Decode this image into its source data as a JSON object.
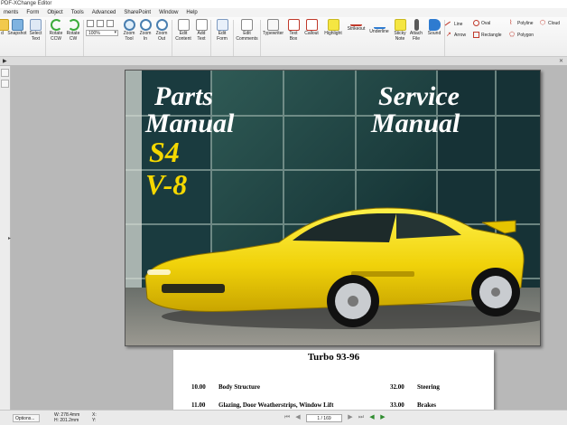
{
  "window": {
    "title": "PDF-XChange Editor"
  },
  "menu": [
    "ments",
    "Form",
    "Object",
    "Tools",
    "Advanced",
    "SharePoint",
    "Window",
    "Help"
  ],
  "toolbar": {
    "hand": {
      "line1": "d",
      "line2": ""
    },
    "snapshot": {
      "line1": "Snapshot",
      "line2": ""
    },
    "select_text": {
      "line1": "Select",
      "line2": "Text"
    },
    "rotate_ccw": {
      "line1": "Rotate",
      "line2": "CCW"
    },
    "rotate_cw": {
      "line1": "Rotate",
      "line2": "CW"
    },
    "zoom_value": "100%",
    "zoom_tool": {
      "line1": "Zoom",
      "line2": "Tool"
    },
    "zoom_in": {
      "line1": "Zoom",
      "line2": "In"
    },
    "zoom_out": {
      "line1": "Zoom",
      "line2": "Out"
    },
    "edit_content": {
      "line1": "Edit",
      "line2": "Content"
    },
    "add_text": {
      "line1": "Add",
      "line2": "Text"
    },
    "edit_form": {
      "line1": "Edit",
      "line2": "Form"
    },
    "edit_comments": {
      "line1": "Edit",
      "line2": "Comments"
    },
    "typewriter": {
      "line1": "Typewriter",
      "line2": ""
    },
    "text_box": {
      "line1": "Text",
      "line2": "Box"
    },
    "callout": {
      "line1": "Callout",
      "line2": ""
    },
    "highlight": {
      "line1": "Highlight",
      "line2": ""
    },
    "strikeout": {
      "line1": "Strikeout",
      "line2": ""
    },
    "underline": {
      "line1": "Underline",
      "line2": ""
    },
    "sticky_note": {
      "line1": "Sticky",
      "line2": "Note"
    },
    "attach_file": {
      "line1": "Attach",
      "line2": "File"
    },
    "sound": {
      "line1": "Sound",
      "line2": ""
    },
    "shapes": {
      "line": "Line",
      "arrow": "Arrow",
      "oval": "Oval",
      "rectangle": "Rectangle",
      "polyline": "Polyline",
      "polygon": "Polygon",
      "cloud": "Cloud"
    }
  },
  "cover": {
    "parts": "Parts",
    "manual_left": "Manual",
    "s4": "S4",
    "v8": "V-8",
    "service": "Service",
    "manual_right": "Manual"
  },
  "page2": {
    "title": "Turbo 93-96",
    "rows": [
      {
        "num": "10.00",
        "label": "Body Structure",
        "num2": "32.00",
        "label2": "Steering"
      },
      {
        "num": "11.00",
        "label": "Glazing, Door Weatherstrips, Window Lift",
        "num2": "33.00",
        "label2": "Brakes"
      }
    ]
  },
  "status": {
    "options": "Options...",
    "width": "W: 278.4mm",
    "height": "H: 201.2mm",
    "x": "X:",
    "y": "Y:",
    "page": "1 / 169"
  },
  "colors": {
    "car_yellow": "#f0d20a",
    "cover_text_white": "#ffffff",
    "cover_text_yellow": "#f5d800",
    "canvas_gray": "#b8b8b8"
  }
}
